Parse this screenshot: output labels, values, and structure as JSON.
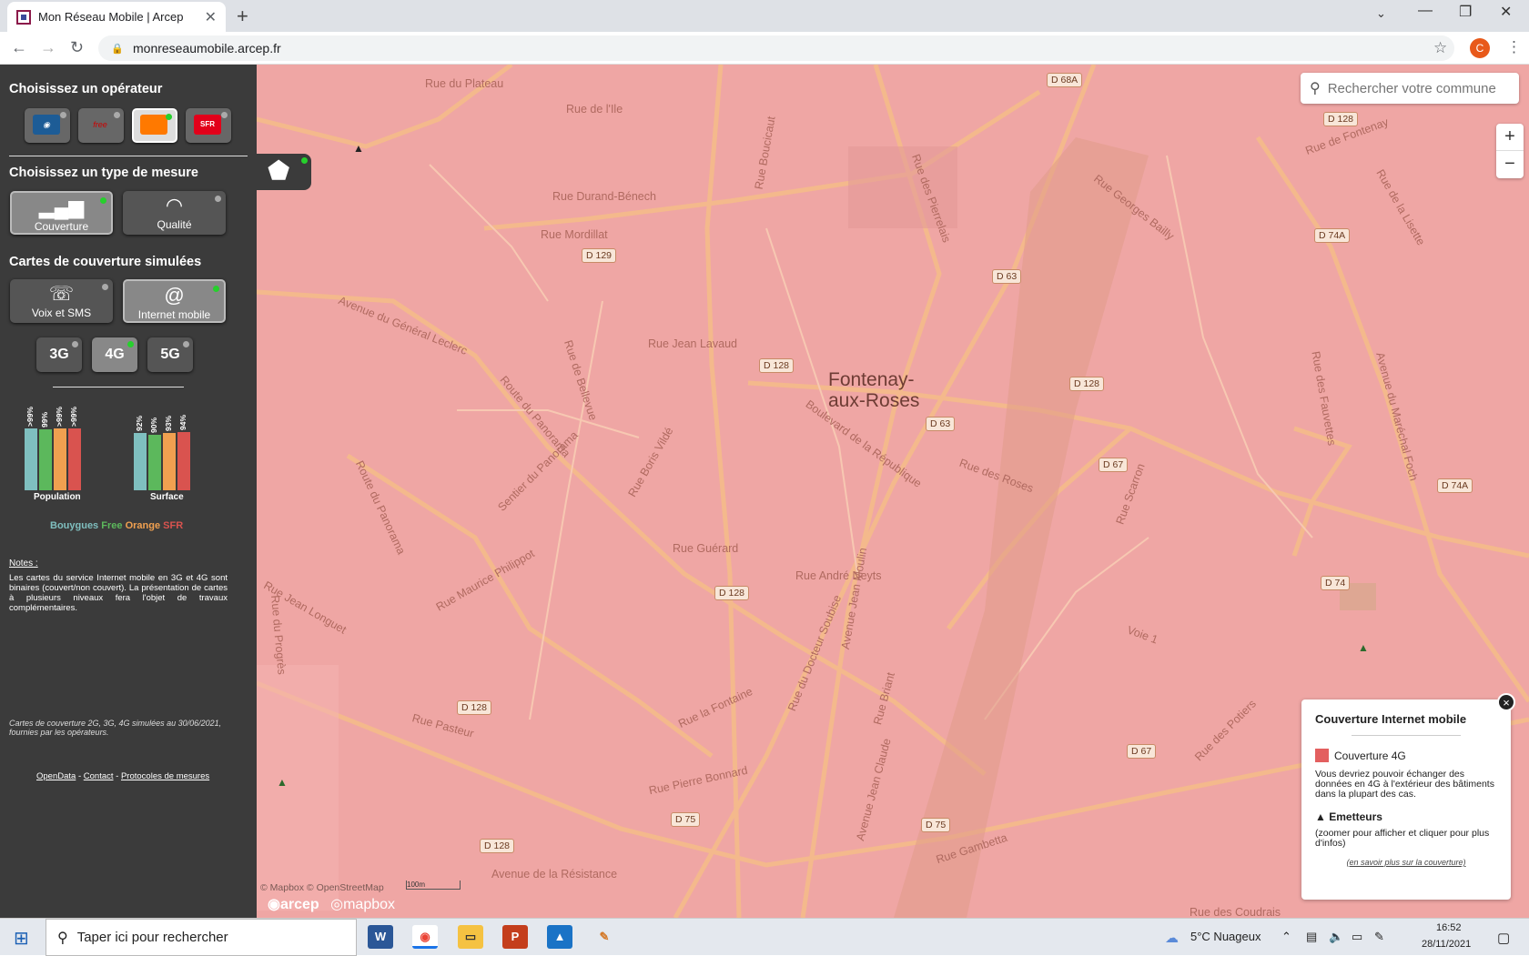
{
  "browser": {
    "tab_title": "Mon Réseau Mobile | Arcep",
    "tab_close": "✕",
    "new_tab": "+",
    "url": "monreseaumobile.arcep.fr",
    "profile_initial": "C"
  },
  "sidebar": {
    "operator_heading": "Choisissez un opérateur",
    "operators": [
      {
        "name": "Bouygues",
        "logo": "",
        "color": "#1d5c96"
      },
      {
        "name": "Free",
        "logo": "free",
        "color": "#cc0000"
      },
      {
        "name": "Orange",
        "logo": "orange",
        "color": "#ff7900"
      },
      {
        "name": "SFR",
        "logo": "SFR",
        "color": "#e2001a"
      }
    ],
    "selected_operator": "Orange",
    "measure_heading": "Choisissez un type de mesure",
    "measures": [
      {
        "label": "Couverture",
        "icon": "signal-bars-icon"
      },
      {
        "label": "Qualité",
        "icon": "gauge-icon"
      }
    ],
    "simulated_heading": "Cartes de couverture simulées",
    "services": [
      {
        "label": "Voix et SMS",
        "icon": "phone-bubble-icon"
      },
      {
        "label": "Internet mobile",
        "icon": "at-sign-icon"
      }
    ],
    "technologies": [
      "3G",
      "4G",
      "5G"
    ],
    "selected_technology": "4G",
    "population_caption": "Population",
    "surface_caption": "Surface",
    "legend_operators": [
      "Bouygues",
      "Free",
      "Orange",
      "SFR"
    ],
    "notes_title": "Notes",
    "notes_colon": " :",
    "notes_text": "Les cartes du service Internet mobile en 3G et 4G sont binaires (couvert/non couvert). La présentation de cartes à plusieurs niveaux fera l'objet de travaux complémentaires.",
    "footnote": "Cartes de couverture 2G, 3G, 4G simulées au 30/06/2021, fournies par les opérateurs.",
    "links": [
      "OpenData",
      "Contact",
      "Protocoles de mesures"
    ],
    "link_sep": " - "
  },
  "chart_data": [
    {
      "type": "bar",
      "title": "Population",
      "categories": [
        "Bouygues",
        "Free",
        "Orange",
        "SFR"
      ],
      "value_labels": [
        ">99%",
        "99%",
        ">99%",
        ">99%"
      ],
      "values": [
        99.5,
        99,
        99.5,
        99.5
      ],
      "colors": [
        "#7fbfbf",
        "#5cb85c",
        "#f0a050",
        "#d9534f"
      ],
      "ylim": [
        0,
        100
      ]
    },
    {
      "type": "bar",
      "title": "Surface",
      "categories": [
        "Bouygues",
        "Free",
        "Orange",
        "SFR"
      ],
      "value_labels": [
        "92%",
        "90%",
        "93%",
        "94%"
      ],
      "values": [
        92,
        90,
        93,
        94
      ],
      "colors": [
        "#7fbfbf",
        "#5cb85c",
        "#f0a050",
        "#d9534f"
      ],
      "ylim": [
        0,
        100
      ]
    }
  ],
  "map": {
    "city_line1": "Fontenay-",
    "city_line2": "aux-Roses",
    "search_placeholder": "Rechercher votre commune",
    "zoom_in": "+",
    "zoom_out": "−",
    "attribution": "© Mapbox © OpenStreetMap",
    "scale": "100m",
    "brand_arcep": "arcep",
    "brand_mapbox": "mapbox",
    "street_labels": [
      "Rue du Plateau",
      "Rue de l'Ile",
      "Rue Durand-Bénech",
      "Rue Mordillat",
      "Avenue du Général Leclerc",
      "Rue Jean Lavaud",
      "Rue de Bellevue",
      "Route du Panorama",
      "Sentier du Panorama",
      "Rue Boris Vildé",
      "Rue Guérard",
      "Rue André Neyts",
      "Boulevard de la République",
      "Rue des Roses",
      "Rue Boucicaut",
      "Rue des Pierrelais",
      "Rue Georges Bailly",
      "Rue de Fontenay",
      "Rue de la Lisette",
      "Rue des Fauvettes",
      "Avenue du Maréchal Foch",
      "Rue Scarron",
      "Rue Maurice Philippot",
      "Rue Jean Longuet",
      "Rue Pasteur",
      "Rue la Fontaine",
      "Rue du Docteur Soubise",
      "Avenue Jean Moulin",
      "Rue Briant",
      "Rue Pierre Bonnard",
      "Avenue de la Résistance",
      "Rue Gambetta",
      "Rue des Potiers",
      "Rue des Coudrais",
      "Avenue Jean Claude",
      "Voie 1",
      "Rue du Progrès",
      "Route du Panorama"
    ],
    "road_tags": [
      "D 68A",
      "D 128",
      "D 74A",
      "D 129",
      "D 63",
      "D 128",
      "D 128",
      "D 63",
      "D 67",
      "D 74A",
      "D 74",
      "D 128",
      "D 128",
      "D 67",
      "D 75",
      "D 75",
      "D 128"
    ]
  },
  "legend": {
    "title": "Couverture Internet mobile",
    "item_label": "Couverture 4G",
    "item_color": "#e35f5f",
    "item_text": "Vous devriez pouvoir échanger des données en 4G à l'extérieur des bâtiments dans la plupart des cas.",
    "emitters_label": "Emetteurs",
    "emitters_text": "(zoomer pour afficher et cliquer pour plus d'infos)",
    "more_link": "(en savoir plus sur la couverture)",
    "close": "×"
  },
  "taskbar": {
    "search_placeholder": "Taper ici pour rechercher",
    "weather": "5°C  Nuageux",
    "time": "16:52",
    "date": "28/11/2021"
  }
}
